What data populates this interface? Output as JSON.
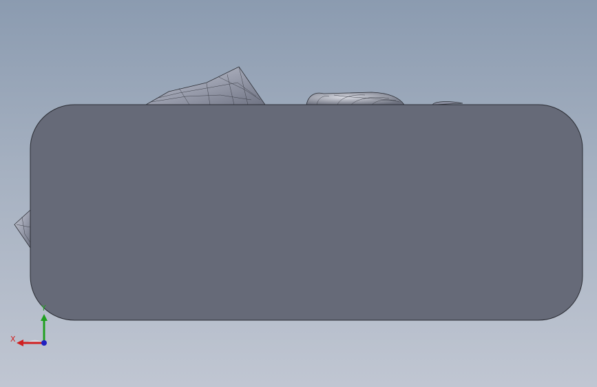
{
  "colors": {
    "background_top": "#8b9bb0",
    "background_bottom": "#c0c6d2",
    "part_face": "#666a78",
    "part_edge": "#2a2c33",
    "mesh_fill": "#9b9fae",
    "axis_x": "#d02020",
    "axis_y": "#20a020",
    "axis_z": "#2020c0"
  },
  "triad": {
    "x_label": "X",
    "y_label": "Y"
  }
}
